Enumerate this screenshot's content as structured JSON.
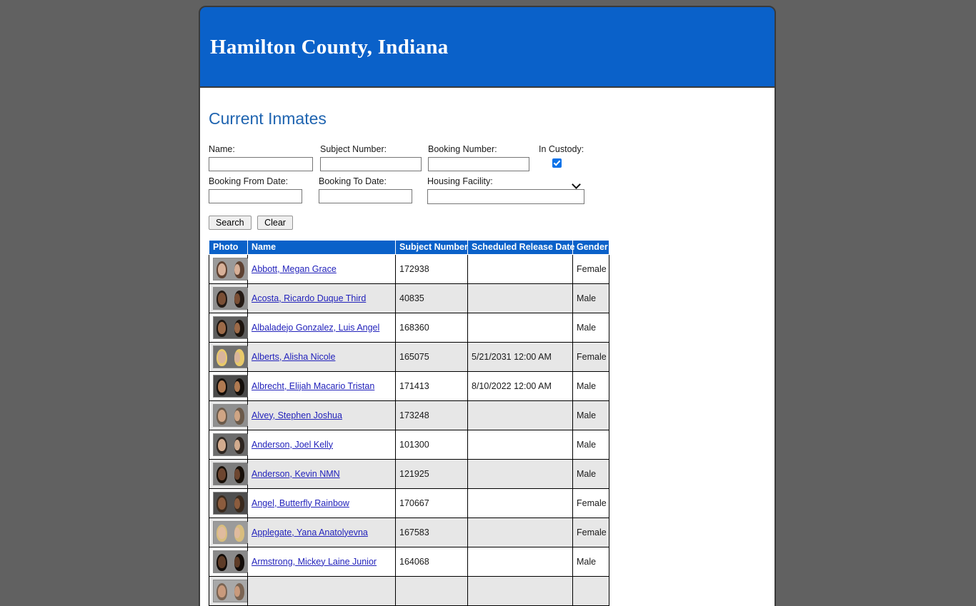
{
  "site": {
    "title": "Hamilton County, Indiana"
  },
  "page": {
    "heading": "Current Inmates"
  },
  "search": {
    "name_label": "Name:",
    "name_value": "",
    "subject_label": "Subject Number:",
    "subject_value": "",
    "booking_label": "Booking Number:",
    "booking_value": "",
    "in_custody_label": "In Custody:",
    "in_custody_checked": true,
    "booking_from_label": "Booking From Date:",
    "booking_from_value": "",
    "booking_to_label": "Booking To Date:",
    "booking_to_value": "",
    "housing_label": "Housing Facility:",
    "housing_value": "",
    "search_button": "Search",
    "clear_button": "Clear"
  },
  "table": {
    "headers": {
      "photo": "Photo",
      "name": "Name",
      "subject_number": "Subject Number",
      "scheduled_release_date": "Scheduled Release Date",
      "gender": "Gender"
    },
    "rows": [
      {
        "name": "Abbott, Megan Grace",
        "subject_number": "172938",
        "scheduled_release_date": "",
        "gender": "Female",
        "skin": "#d7b098",
        "hair": "#5e4232",
        "bg": "#9a9a9a"
      },
      {
        "name": "Acosta, Ricardo Duque Third",
        "subject_number": "40835",
        "scheduled_release_date": "",
        "gender": "Male",
        "skin": "#7a4f35",
        "hair": "#241a14",
        "bg": "#8d8d8d"
      },
      {
        "name": "Albaladejo Gonzalez, Luis Angel",
        "subject_number": "168360",
        "scheduled_release_date": "",
        "gender": "Male",
        "skin": "#9c6a48",
        "hair": "#1d150f",
        "bg": "#5d5d5d"
      },
      {
        "name": "Alberts, Alisha Nicole",
        "subject_number": "165075",
        "scheduled_release_date": "5/21/2031 12:00 AM",
        "gender": "Female",
        "skin": "#d9b49c",
        "hair": "#e8c96a",
        "bg": "#6f6f6f"
      },
      {
        "name": "Albrecht, Elijah Macario Tristan",
        "subject_number": "171413",
        "scheduled_release_date": "8/10/2022 12:00 AM",
        "gender": "Male",
        "skin": "#b07a52",
        "hair": "#140f0b",
        "bg": "#4a4a4a"
      },
      {
        "name": "Alvey, Stephen Joshua",
        "subject_number": "173248",
        "scheduled_release_date": "",
        "gender": "Male",
        "skin": "#cfa585",
        "hair": "#6b5a4a",
        "bg": "#8f8f8f"
      },
      {
        "name": "Anderson, Joel Kelly",
        "subject_number": "101300",
        "scheduled_release_date": "",
        "gender": "Male",
        "skin": "#d2ab8e",
        "hair": "#2e2620",
        "bg": "#6c6c6c"
      },
      {
        "name": "Anderson, Kevin NMN",
        "subject_number": "121925",
        "scheduled_release_date": "",
        "gender": "Male",
        "skin": "#6d4630",
        "hair": "#181009",
        "bg": "#7d7d7d"
      },
      {
        "name": "Angel, Butterfly Rainbow",
        "subject_number": "170667",
        "scheduled_release_date": "",
        "gender": "Female",
        "skin": "#8b5c3e",
        "hair": "#3a2a1d",
        "bg": "#4f4f4f"
      },
      {
        "name": "Applegate, Yana Anatolyevna",
        "subject_number": "167583",
        "scheduled_release_date": "",
        "gender": "Female",
        "skin": "#e0bb9e",
        "hair": "#d8bd7e",
        "bg": "#9b9b9b"
      },
      {
        "name": "Armstrong, Mickey Laine Junior",
        "subject_number": "164068",
        "scheduled_release_date": "",
        "gender": "Male",
        "skin": "#5e3c27",
        "hair": "#120c08",
        "bg": "#8a8a8a"
      }
    ],
    "partial_row": {
      "skin": "#c99a7c",
      "hair": "#7a6453",
      "bg": "#a8a8a8"
    }
  },
  "colors": {
    "brand_blue": "#0a61c9",
    "heading_blue": "#1f64b0",
    "link_blue": "#2222bb",
    "page_background": "#616161",
    "row_alt": "#e7e7e7"
  }
}
